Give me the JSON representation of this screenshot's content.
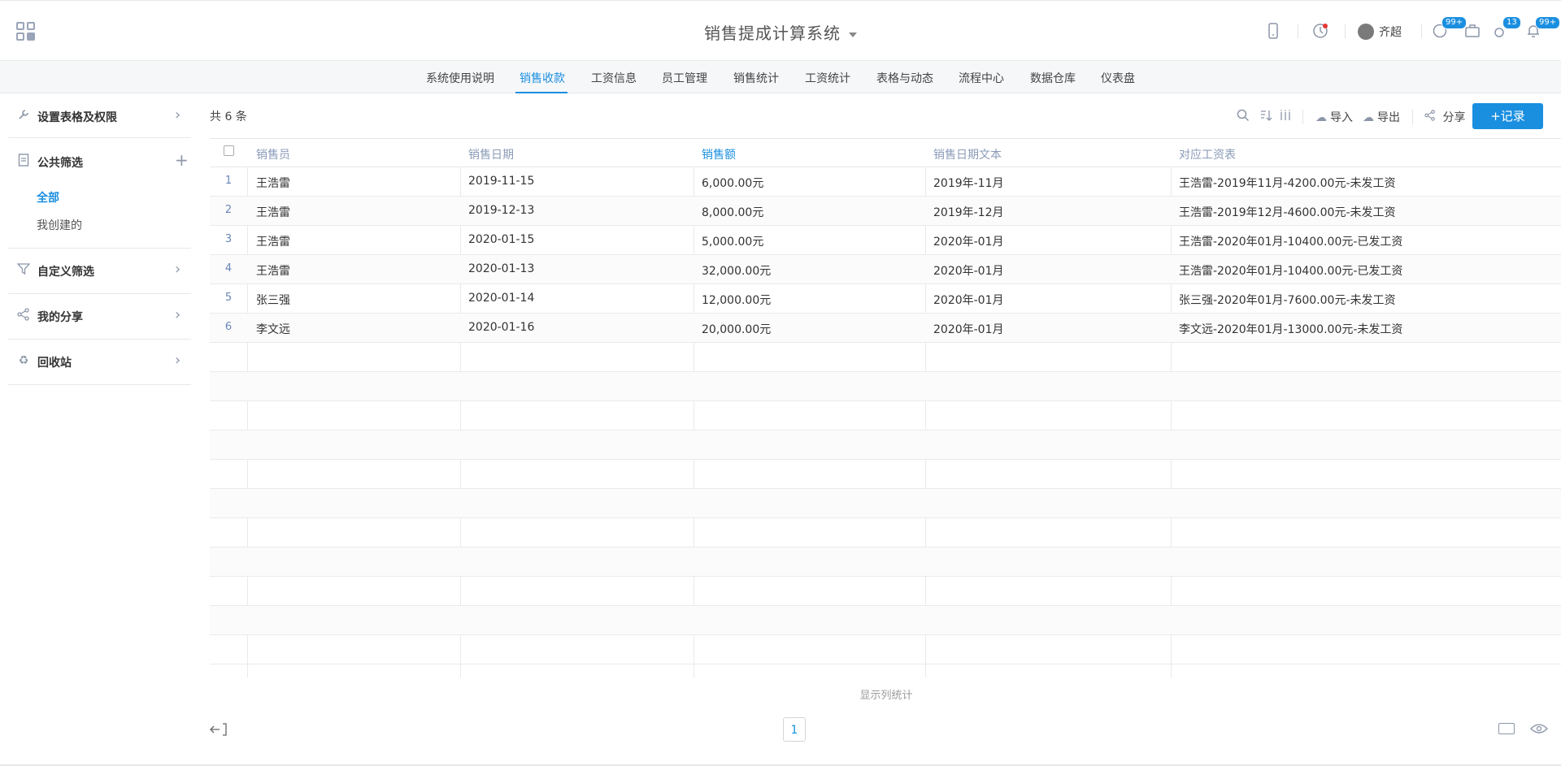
{
  "app": {
    "title": "销售提成计算系统",
    "username": "齐超",
    "badges": {
      "messages": "99+",
      "tasks": "13",
      "notifications": "99+"
    }
  },
  "nav": {
    "tabs": [
      "系统使用说明",
      "销售收款",
      "工资信息",
      "员工管理",
      "销售统计",
      "工资统计",
      "表格与动态",
      "流程中心",
      "数据仓库",
      "仪表盘"
    ],
    "active": "销售收款"
  },
  "sidebar": {
    "settings": "设置表格及权限",
    "public_filter": "公共筛选",
    "all": "全部",
    "mine": "我创建的",
    "custom_filter": "自定义筛选",
    "my_share": "我的分享",
    "recycle": "回收站"
  },
  "toolbar": {
    "count": "共 6 条",
    "import": "导入",
    "export": "导出",
    "share": "分享",
    "add": "+记录"
  },
  "table": {
    "columns": [
      "销售员",
      "销售日期",
      "销售额",
      "销售日期文本",
      "对应工资表"
    ],
    "rows": [
      [
        "1",
        "王浩雷",
        "2019-11-15",
        "6,000.00元",
        "2019年-11月",
        "王浩雷-2019年11月-4200.00元-未发工资"
      ],
      [
        "2",
        "王浩雷",
        "2019-12-13",
        "8,000.00元",
        "2019年-12月",
        "王浩雷-2019年12月-4600.00元-未发工资"
      ],
      [
        "3",
        "王浩雷",
        "2020-01-15",
        "5,000.00元",
        "2020年-01月",
        "王浩雷-2020年01月-10400.00元-已发工资"
      ],
      [
        "4",
        "王浩雷",
        "2020-01-13",
        "32,000.00元",
        "2020年-01月",
        "王浩雷-2020年01月-10400.00元-已发工资"
      ],
      [
        "5",
        "张三强",
        "2020-01-14",
        "12,000.00元",
        "2020年-01月",
        "张三强-2020年01月-7600.00元-未发工资"
      ],
      [
        "6",
        "李文远",
        "2020-01-16",
        "20,000.00元",
        "2020年-01月",
        "李文远-2020年01月-13000.00元-未发工资"
      ]
    ]
  },
  "footer": {
    "column_stats": "显示列统计",
    "page": "1"
  },
  "colors": {
    "accent": "#1a8fe0"
  }
}
